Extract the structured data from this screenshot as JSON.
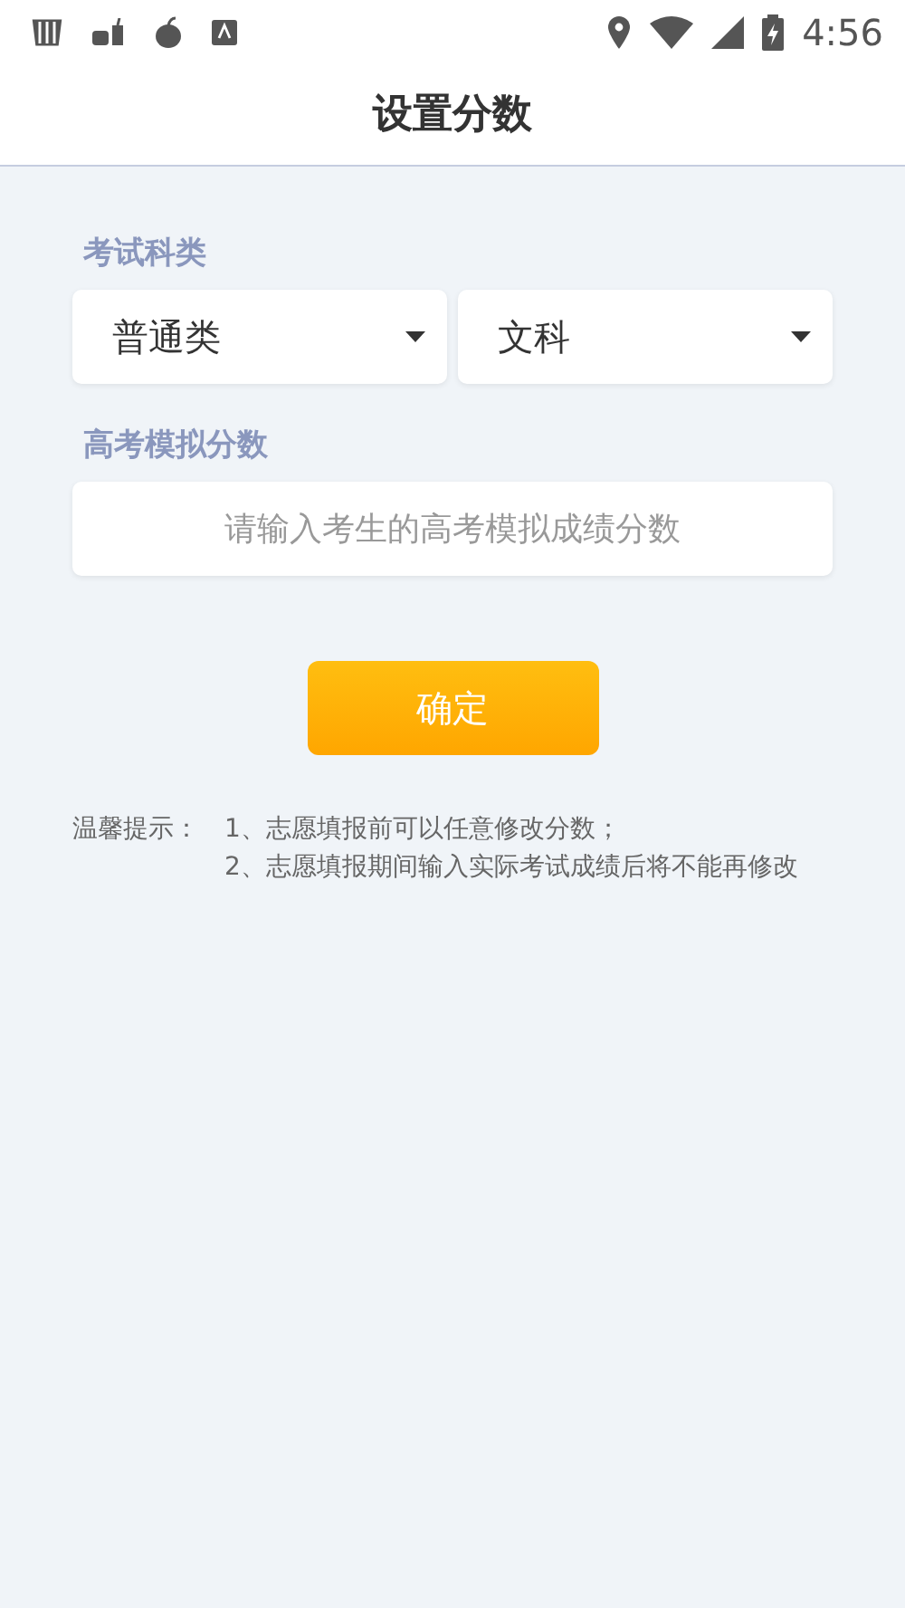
{
  "status_bar": {
    "time": "4:56"
  },
  "header": {
    "title": "设置分数"
  },
  "subject_section": {
    "label": "考试科类",
    "dropdowns": [
      {
        "value": "普通类"
      },
      {
        "value": "文科"
      }
    ]
  },
  "score_section": {
    "label": "高考模拟分数",
    "field": {
      "placeholder": "请输入考生的高考模拟成绩分数"
    }
  },
  "confirm_button": "确定",
  "tips": {
    "label": "温馨提示：",
    "items": [
      "1、志愿填报前可以任意修改分数；",
      "2、志愿填报期间输入实际考试成绩后将不能再修改"
    ]
  }
}
